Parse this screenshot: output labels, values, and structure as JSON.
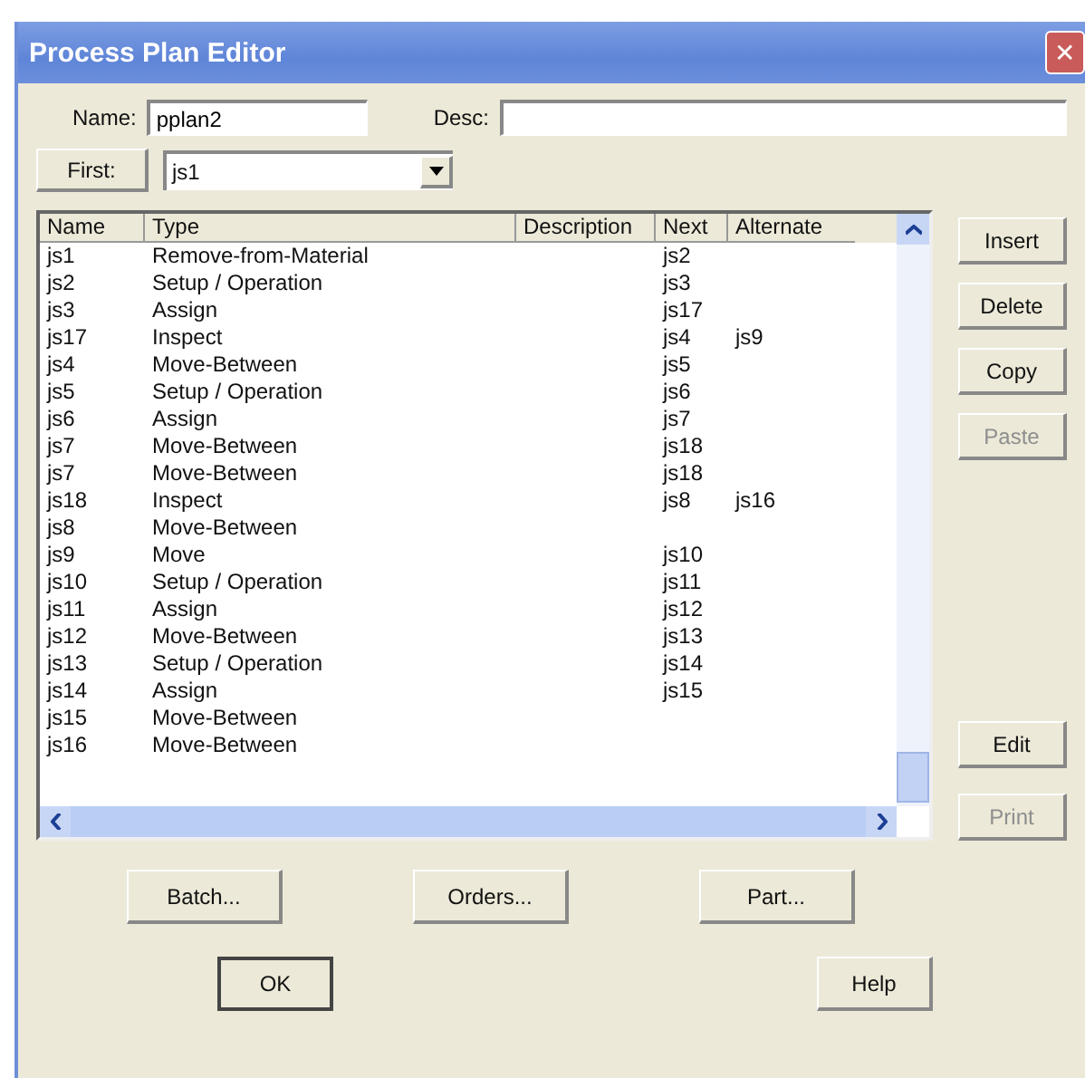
{
  "window": {
    "title": "Process Plan Editor",
    "close": "✕"
  },
  "name_field": {
    "label": "Name:",
    "value": "pplan2"
  },
  "desc_field": {
    "label": "Desc:"
  },
  "first": {
    "button": "First:",
    "value": "js1"
  },
  "table": {
    "columns": [
      "Name",
      "Type",
      "Description",
      "Next",
      "Alternate"
    ],
    "rows": [
      {
        "name": "js1",
        "type": "Remove-from-Material",
        "next": "js2"
      },
      {
        "name": "js2",
        "type": "Setup / Operation",
        "next": "js3"
      },
      {
        "name": "js3",
        "type": "Assign",
        "next": "js17"
      },
      {
        "name": "js17",
        "type": "Inspect",
        "next": "js4",
        "alternate": "js9"
      },
      {
        "name": "js4",
        "type": "Move-Between",
        "next": "js5"
      },
      {
        "name": "js5",
        "type": "Setup / Operation",
        "next": "js6"
      },
      {
        "name": "js6",
        "type": "Assign",
        "next": "js7"
      },
      {
        "name": "js7",
        "type": "Move-Between",
        "next": "js18"
      },
      {
        "name": "js7",
        "type": "Move-Between",
        "next": "js18"
      },
      {
        "name": "js18",
        "type": "Inspect",
        "next": "js8",
        "alternate": "js16"
      },
      {
        "name": "js8",
        "type": "Move-Between"
      },
      {
        "name": "js9",
        "type": "Move",
        "next": "js10"
      },
      {
        "name": "js10",
        "type": "Setup / Operation",
        "next": "js11"
      },
      {
        "name": "js11",
        "type": "Assign",
        "next": "js12"
      },
      {
        "name": "js12",
        "type": "Move-Between",
        "next": "js13"
      },
      {
        "name": "js13",
        "type": "Setup / Operation",
        "next": "js14"
      },
      {
        "name": "js14",
        "type": "Assign",
        "next": "js15"
      },
      {
        "name": "js15",
        "type": "Move-Between"
      },
      {
        "name": "js16",
        "type": "Move-Between"
      }
    ]
  },
  "side_buttons": [
    {
      "label": "Insert",
      "disabled": false
    },
    {
      "label": "Delete",
      "disabled": false
    },
    {
      "label": "Copy",
      "disabled": false
    },
    {
      "label": "Paste",
      "disabled": true
    }
  ],
  "side_buttons_lower": [
    {
      "label": "Edit",
      "disabled": false
    },
    {
      "label": "Print",
      "disabled": true
    }
  ],
  "bottom_buttons": [
    {
      "label": "Batch...",
      "disabled": false
    },
    {
      "label": "Orders...",
      "disabled": false
    },
    {
      "label": "Part...",
      "disabled": false
    }
  ],
  "dialog_buttons": [
    {
      "label": "OK",
      "default": true
    },
    {
      "label": "Help",
      "default": false
    }
  ]
}
